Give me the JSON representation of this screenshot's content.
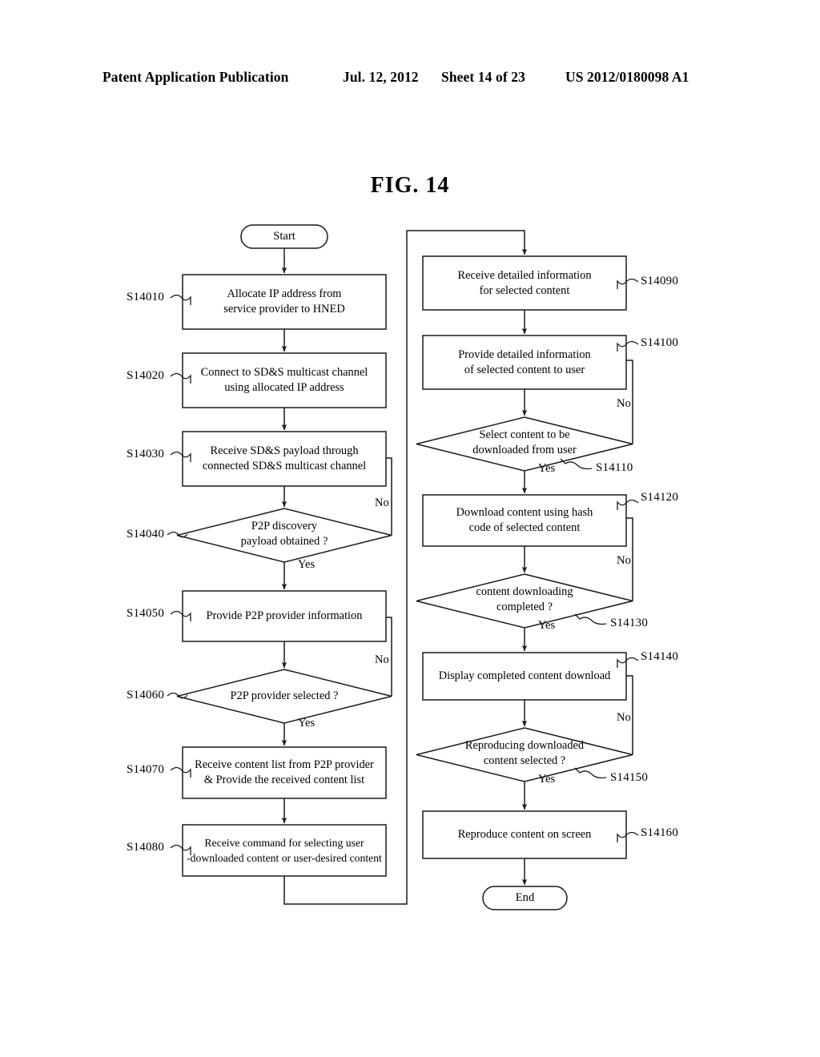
{
  "header": {
    "publication": "Patent Application Publication",
    "date": "Jul. 12, 2012",
    "sheet": "Sheet 14 of 23",
    "number": "US 2012/0180098 A1"
  },
  "figure": {
    "title": "FIG. 14"
  },
  "flowchart": {
    "type": "flowchart",
    "terminators": {
      "start": "Start",
      "end": "End"
    },
    "branch_labels": {
      "yes": "Yes",
      "no": "No"
    },
    "left_column": [
      {
        "ref": "S14010",
        "shape": "process",
        "line1": "Allocate IP address from",
        "line2": "service provider to HNED"
      },
      {
        "ref": "S14020",
        "shape": "process",
        "line1": "Connect to SD&S multicast channel",
        "line2": "using allocated IP address"
      },
      {
        "ref": "S14030",
        "shape": "process",
        "line1": "Receive SD&S payload through",
        "line2": "connected SD&S multicast channel"
      },
      {
        "ref": "S14040",
        "shape": "decision",
        "line1": "P2P discovery",
        "line2": "payload obtained ?"
      },
      {
        "ref": "S14050",
        "shape": "process",
        "line1": "Provide P2P provider information",
        "line2": ""
      },
      {
        "ref": "S14060",
        "shape": "decision",
        "line1": "P2P provider selected ?",
        "line2": ""
      },
      {
        "ref": "S14070",
        "shape": "process",
        "line1": "Receive content list from P2P provider",
        "line2": "& Provide the received content list"
      },
      {
        "ref": "S14080",
        "shape": "process",
        "line1": "Receive command for selecting user",
        "line2": "-downloaded content or user-desired content"
      }
    ],
    "right_column": [
      {
        "ref": "S14090",
        "shape": "process",
        "line1": "Receive detailed information",
        "line2": "for selected content"
      },
      {
        "ref": "S14100",
        "shape": "process",
        "line1": "Provide detailed information",
        "line2": "of selected content to user"
      },
      {
        "ref": "S14110",
        "shape": "decision",
        "line1": "Select content to be",
        "line2": "downloaded from user"
      },
      {
        "ref": "S14120",
        "shape": "process",
        "line1": "Download content using hash",
        "line2": "code of selected content"
      },
      {
        "ref": "S14130",
        "shape": "decision",
        "line1": "content downloading",
        "line2": "completed ?"
      },
      {
        "ref": "S14140",
        "shape": "process",
        "line1": "Display completed content download",
        "line2": ""
      },
      {
        "ref": "S14150",
        "shape": "decision",
        "line1": "Reproducing downloaded",
        "line2": "content selected ?"
      },
      {
        "ref": "S14160",
        "shape": "process",
        "line1": "Reproduce content on screen",
        "line2": ""
      }
    ],
    "colors": {
      "stroke": "#1a1a1a",
      "background": "#ffffff"
    }
  }
}
